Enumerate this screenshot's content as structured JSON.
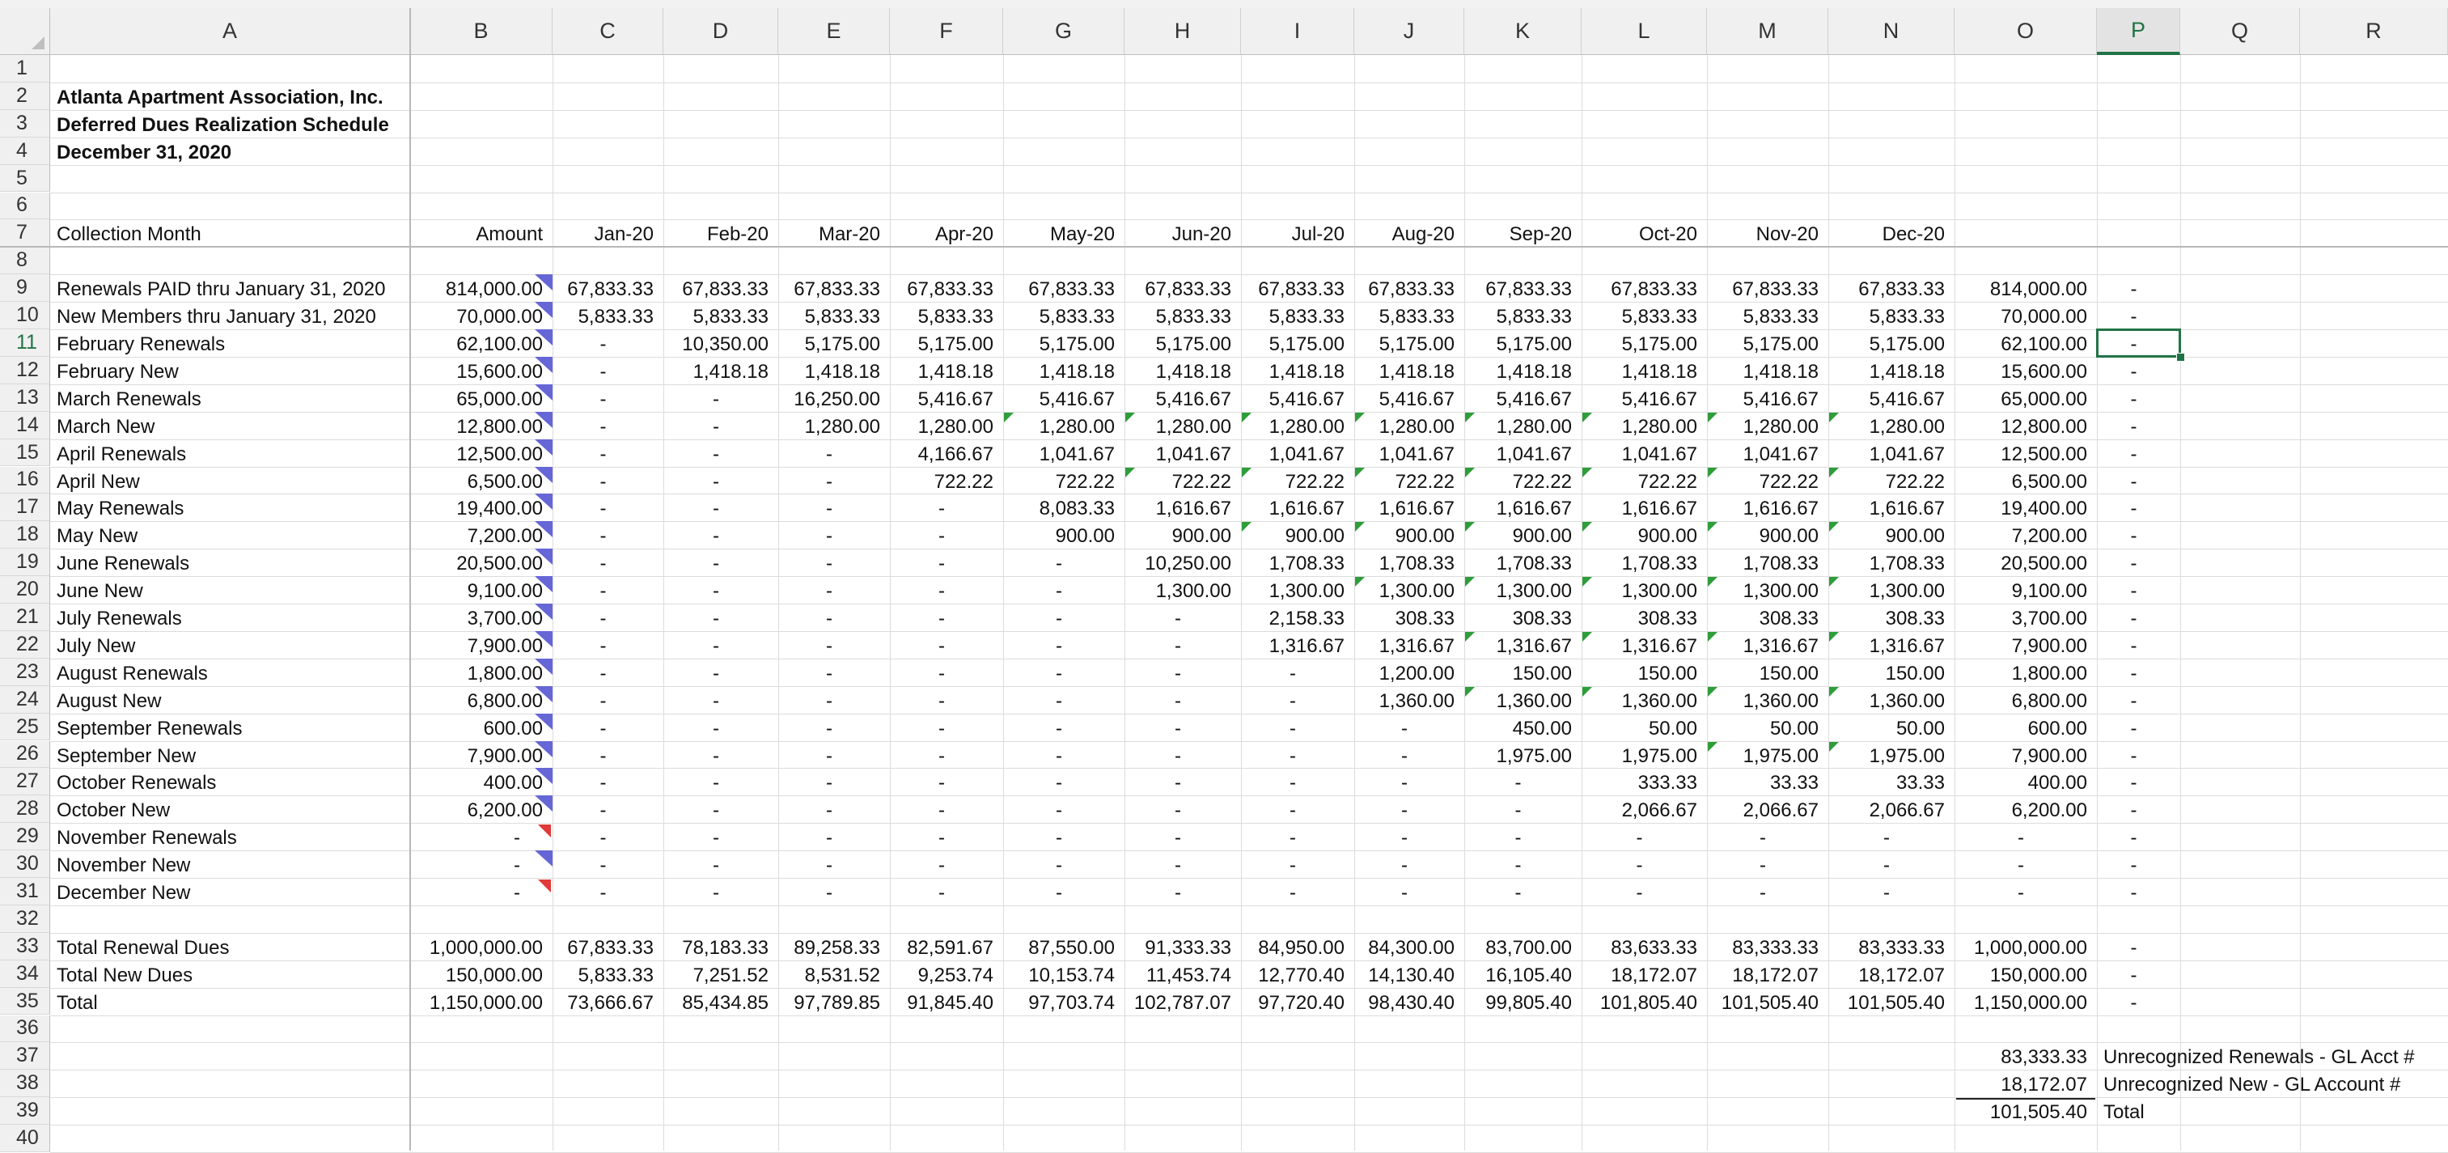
{
  "columns": [
    "A",
    "B",
    "C",
    "D",
    "E",
    "F",
    "G",
    "H",
    "I",
    "J",
    "K",
    "L",
    "M",
    "N",
    "O",
    "P",
    "Q",
    "R"
  ],
  "selected_column": "P",
  "selected_row": 11,
  "row_numbers": [
    1,
    2,
    3,
    4,
    5,
    6,
    7,
    8,
    9,
    10,
    11,
    12,
    13,
    14,
    15,
    16,
    17,
    18,
    19,
    20,
    21,
    22,
    23,
    24,
    25,
    26,
    27,
    28,
    29,
    30,
    31,
    32,
    33,
    34,
    35,
    36,
    37,
    38,
    39,
    40
  ],
  "title": {
    "line1": "Atlanta Apartment Association, Inc.",
    "line2": "Deferred Dues Realization Schedule",
    "line3": "December 31, 2020"
  },
  "header_row": {
    "label": "Collection Month",
    "amount": "Amount",
    "months": [
      "Jan-20",
      "Feb-20",
      "Mar-20",
      "Apr-20",
      "May-20",
      "Jun-20",
      "Jul-20",
      "Aug-20",
      "Sep-20",
      "Oct-20",
      "Nov-20",
      "Dec-20"
    ]
  },
  "rows": [
    {
      "r": 9,
      "label": "Renewals PAID thru January 31, 2020",
      "amount": "814,000.00",
      "m": [
        "67,833.33",
        "67,833.33",
        "67,833.33",
        "67,833.33",
        "67,833.33",
        "67,833.33",
        "67,833.33",
        "67,833.33",
        "67,833.33",
        "67,833.33",
        "67,833.33",
        "67,833.33"
      ],
      "total": "814,000.00",
      "p": "-",
      "note": "blue"
    },
    {
      "r": 10,
      "label": "New Members thru January 31, 2020",
      "amount": "70,000.00",
      "m": [
        "5,833.33",
        "5,833.33",
        "5,833.33",
        "5,833.33",
        "5,833.33",
        "5,833.33",
        "5,833.33",
        "5,833.33",
        "5,833.33",
        "5,833.33",
        "5,833.33",
        "5,833.33"
      ],
      "total": "70,000.00",
      "p": "-",
      "note": "blue"
    },
    {
      "r": 11,
      "label": "February Renewals",
      "amount": "62,100.00",
      "m": [
        "-",
        "10,350.00",
        "5,175.00",
        "5,175.00",
        "5,175.00",
        "5,175.00",
        "5,175.00",
        "5,175.00",
        "5,175.00",
        "5,175.00",
        "5,175.00",
        "5,175.00"
      ],
      "total": "62,100.00",
      "p": "-",
      "note": "blue"
    },
    {
      "r": 12,
      "label": "February New",
      "amount": "15,600.00",
      "m": [
        "-",
        "1,418.18",
        "1,418.18",
        "1,418.18",
        "1,418.18",
        "1,418.18",
        "1,418.18",
        "1,418.18",
        "1,418.18",
        "1,418.18",
        "1,418.18",
        "1,418.18"
      ],
      "total": "15,600.00",
      "p": "-",
      "note": "blue"
    },
    {
      "r": 13,
      "label": "March Renewals",
      "amount": "65,000.00",
      "m": [
        "-",
        "-",
        "16,250.00",
        "5,416.67",
        "5,416.67",
        "5,416.67",
        "5,416.67",
        "5,416.67",
        "5,416.67",
        "5,416.67",
        "5,416.67",
        "5,416.67"
      ],
      "total": "65,000.00",
      "p": "-",
      "note": "blue"
    },
    {
      "r": 14,
      "label": "March New",
      "amount": "12,800.00",
      "m": [
        "-",
        "-",
        "1,280.00",
        "1,280.00",
        "1,280.00",
        "1,280.00",
        "1,280.00",
        "1,280.00",
        "1,280.00",
        "1,280.00",
        "1,280.00",
        "1,280.00"
      ],
      "total": "12,800.00",
      "p": "-",
      "note": "blue",
      "green": [
        4,
        5,
        6,
        7,
        8,
        9,
        10,
        11
      ]
    },
    {
      "r": 15,
      "label": "April Renewals",
      "amount": "12,500.00",
      "m": [
        "-",
        "-",
        "-",
        "4,166.67",
        "1,041.67",
        "1,041.67",
        "1,041.67",
        "1,041.67",
        "1,041.67",
        "1,041.67",
        "1,041.67",
        "1,041.67"
      ],
      "total": "12,500.00",
      "p": "-",
      "note": "blue"
    },
    {
      "r": 16,
      "label": "April New",
      "amount": "6,500.00",
      "m": [
        "-",
        "-",
        "-",
        "722.22",
        "722.22",
        "722.22",
        "722.22",
        "722.22",
        "722.22",
        "722.22",
        "722.22",
        "722.22"
      ],
      "total": "6,500.00",
      "p": "-",
      "note": "blue",
      "green": [
        5,
        6,
        7,
        8,
        9,
        10,
        11
      ]
    },
    {
      "r": 17,
      "label": "May Renewals",
      "amount": "19,400.00",
      "m": [
        "-",
        "-",
        "-",
        "-",
        "8,083.33",
        "1,616.67",
        "1,616.67",
        "1,616.67",
        "1,616.67",
        "1,616.67",
        "1,616.67",
        "1,616.67"
      ],
      "total": "19,400.00",
      "p": "-",
      "note": "blue"
    },
    {
      "r": 18,
      "label": "May New",
      "amount": "7,200.00",
      "m": [
        "-",
        "-",
        "-",
        "-",
        "900.00",
        "900.00",
        "900.00",
        "900.00",
        "900.00",
        "900.00",
        "900.00",
        "900.00"
      ],
      "total": "7,200.00",
      "p": "-",
      "note": "blue",
      "green": [
        6,
        7,
        8,
        9,
        10,
        11
      ]
    },
    {
      "r": 19,
      "label": "June Renewals",
      "amount": "20,500.00",
      "m": [
        "-",
        "-",
        "-",
        "-",
        "-",
        "10,250.00",
        "1,708.33",
        "1,708.33",
        "1,708.33",
        "1,708.33",
        "1,708.33",
        "1,708.33"
      ],
      "total": "20,500.00",
      "p": "-",
      "note": "blue"
    },
    {
      "r": 20,
      "label": "June New",
      "amount": "9,100.00",
      "m": [
        "-",
        "-",
        "-",
        "-",
        "-",
        "1,300.00",
        "1,300.00",
        "1,300.00",
        "1,300.00",
        "1,300.00",
        "1,300.00",
        "1,300.00"
      ],
      "total": "9,100.00",
      "p": "-",
      "note": "blue",
      "green": [
        7,
        8,
        9,
        10,
        11
      ]
    },
    {
      "r": 21,
      "label": "July Renewals",
      "amount": "3,700.00",
      "m": [
        "-",
        "-",
        "-",
        "-",
        "-",
        "-",
        "2,158.33",
        "308.33",
        "308.33",
        "308.33",
        "308.33",
        "308.33"
      ],
      "total": "3,700.00",
      "p": "-",
      "note": "blue"
    },
    {
      "r": 22,
      "label": "July New",
      "amount": "7,900.00",
      "m": [
        "-",
        "-",
        "-",
        "-",
        "-",
        "-",
        "1,316.67",
        "1,316.67",
        "1,316.67",
        "1,316.67",
        "1,316.67",
        "1,316.67"
      ],
      "total": "7,900.00",
      "p": "-",
      "note": "blue",
      "green": [
        8,
        9,
        10,
        11
      ]
    },
    {
      "r": 23,
      "label": "August Renewals",
      "amount": "1,800.00",
      "m": [
        "-",
        "-",
        "-",
        "-",
        "-",
        "-",
        "-",
        "1,200.00",
        "150.00",
        "150.00",
        "150.00",
        "150.00"
      ],
      "total": "1,800.00",
      "p": "-",
      "note": "blue"
    },
    {
      "r": 24,
      "label": "August New",
      "amount": "6,800.00",
      "m": [
        "-",
        "-",
        "-",
        "-",
        "-",
        "-",
        "-",
        "1,360.00",
        "1,360.00",
        "1,360.00",
        "1,360.00",
        "1,360.00"
      ],
      "total": "6,800.00",
      "p": "-",
      "note": "blue",
      "green": [
        8,
        9,
        10,
        11
      ]
    },
    {
      "r": 25,
      "label": "September Renewals",
      "amount": "600.00",
      "m": [
        "-",
        "-",
        "-",
        "-",
        "-",
        "-",
        "-",
        "-",
        "450.00",
        "50.00",
        "50.00",
        "50.00"
      ],
      "total": "600.00",
      "p": "-",
      "note": "blue"
    },
    {
      "r": 26,
      "label": "September New",
      "amount": "7,900.00",
      "m": [
        "-",
        "-",
        "-",
        "-",
        "-",
        "-",
        "-",
        "-",
        "1,975.00",
        "1,975.00",
        "1,975.00",
        "1,975.00"
      ],
      "total": "7,900.00",
      "p": "-",
      "note": "blue",
      "green": [
        10,
        11
      ]
    },
    {
      "r": 27,
      "label": "October Renewals",
      "amount": "400.00",
      "m": [
        "-",
        "-",
        "-",
        "-",
        "-",
        "-",
        "-",
        "-",
        "-",
        "333.33",
        "33.33",
        "33.33"
      ],
      "total": "400.00",
      "p": "-",
      "note": "blue"
    },
    {
      "r": 28,
      "label": "October New",
      "amount": "6,200.00",
      "m": [
        "-",
        "-",
        "-",
        "-",
        "-",
        "-",
        "-",
        "-",
        "-",
        "2,066.67",
        "2,066.67",
        "2,066.67"
      ],
      "total": "6,200.00",
      "p": "-",
      "note": "blue"
    },
    {
      "r": 29,
      "label": "November Renewals",
      "amount": "-",
      "m": [
        "-",
        "-",
        "-",
        "-",
        "-",
        "-",
        "-",
        "-",
        "-",
        "-",
        "-",
        "-"
      ],
      "total": "-",
      "p": "-",
      "note": "red"
    },
    {
      "r": 30,
      "label": "November New",
      "amount": "-",
      "m": [
        "-",
        "-",
        "-",
        "-",
        "-",
        "-",
        "-",
        "-",
        "-",
        "-",
        "-",
        "-"
      ],
      "total": "-",
      "p": "-",
      "note": "blue"
    },
    {
      "r": 31,
      "label": "December New",
      "amount": "-",
      "m": [
        "-",
        "-",
        "-",
        "-",
        "-",
        "-",
        "-",
        "-",
        "-",
        "-",
        "-",
        "-"
      ],
      "total": "-",
      "p": "-",
      "note": "red"
    },
    {
      "r": 33,
      "label": "Total Renewal Dues",
      "amount": "1,000,000.00",
      "m": [
        "67,833.33",
        "78,183.33",
        "89,258.33",
        "82,591.67",
        "87,550.00",
        "91,333.33",
        "84,950.00",
        "84,300.00",
        "83,700.00",
        "83,633.33",
        "83,333.33",
        "83,333.33"
      ],
      "total": "1,000,000.00",
      "p": "-"
    },
    {
      "r": 34,
      "label": "Total New Dues",
      "amount": "150,000.00",
      "m": [
        "5,833.33",
        "7,251.52",
        "8,531.52",
        "9,253.74",
        "10,153.74",
        "11,453.74",
        "12,770.40",
        "14,130.40",
        "16,105.40",
        "18,172.07",
        "18,172.07",
        "18,172.07"
      ],
      "total": "150,000.00",
      "p": "-"
    },
    {
      "r": 35,
      "label": "Total",
      "amount": "1,150,000.00",
      "m": [
        "73,666.67",
        "85,434.85",
        "97,789.85",
        "91,845.40",
        "97,703.74",
        "102,787.07",
        "97,720.40",
        "98,430.40",
        "99,805.40",
        "101,805.40",
        "101,505.40",
        "101,505.40"
      ],
      "total": "1,150,000.00",
      "p": "-"
    }
  ],
  "summary": [
    {
      "r": 37,
      "value": "83,333.33",
      "label": "Unrecognized Renewals - GL Acct #"
    },
    {
      "r": 38,
      "value": "18,172.07",
      "label": "Unrecognized New - GL Account #"
    },
    {
      "r": 39,
      "value": "101,505.40",
      "label": "Total"
    }
  ]
}
